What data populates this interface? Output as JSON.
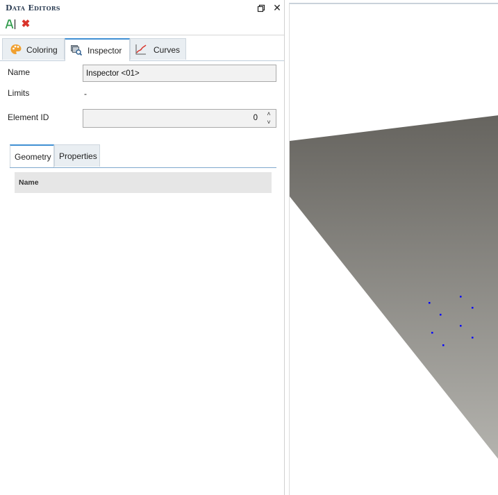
{
  "panel": {
    "title": "Data Editors",
    "restore_icon": "restore-window-icon",
    "close_glyph": "✕",
    "rename_icon": "rename-icon",
    "delete_glyph": "✖",
    "delete_color": "#d9342b"
  },
  "tabs": [
    {
      "label": "Coloring",
      "icon": "palette-icon"
    },
    {
      "label": "Inspector",
      "icon": "inspector-icon",
      "active": true
    },
    {
      "label": "Curves",
      "icon": "curves-icon"
    }
  ],
  "form": {
    "name_label": "Name",
    "name_value": "Inspector <01>",
    "limits_label": "Limits",
    "limits_value": "-",
    "element_id_label": "Element ID",
    "element_id_value": "0",
    "spin_up": "˄",
    "spin_down": "˅"
  },
  "subtabs": [
    {
      "label": "Geometry",
      "active": true
    },
    {
      "label": "Properties"
    }
  ],
  "grid": {
    "columns": [
      "Name"
    ]
  },
  "viewport": {
    "surface_color_top": "#66645f",
    "surface_color_bottom": "#b4b3ae",
    "point_color": "#0000ff",
    "accent": "#3f8fd3"
  }
}
